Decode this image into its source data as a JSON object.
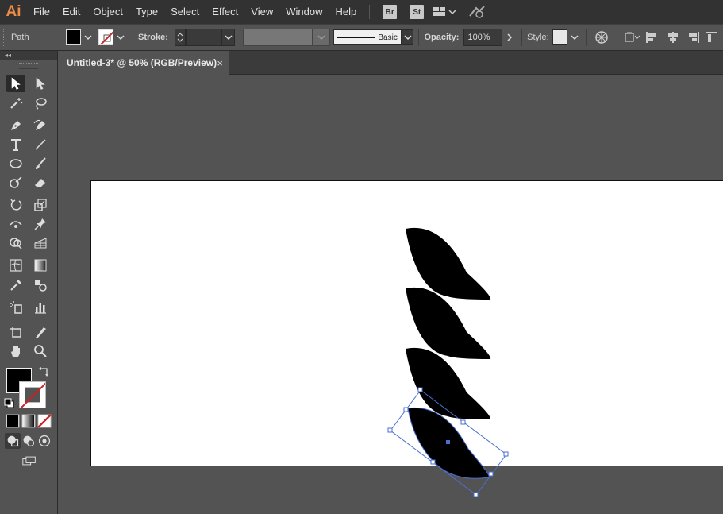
{
  "app": {
    "logo": "Ai",
    "brand_color": "#ee8c47"
  },
  "menu": {
    "items": [
      {
        "label": "File"
      },
      {
        "label": "Edit"
      },
      {
        "label": "Object"
      },
      {
        "label": "Type"
      },
      {
        "label": "Select"
      },
      {
        "label": "Effect"
      },
      {
        "label": "View"
      },
      {
        "label": "Window"
      },
      {
        "label": "Help"
      }
    ],
    "bridge_label": "Br",
    "stock_label": "St",
    "workspace_icon": "workspace-switcher-icon",
    "gpu_icon": "gpu-performance-icon"
  },
  "control": {
    "selection_type": "Path",
    "fill_color": "#000000",
    "stroke_color": "none",
    "stroke_label": "Stroke:",
    "stroke_value": "",
    "brush_label": "Basic",
    "opacity_label": "Opacity:",
    "opacity_value": "100%",
    "style_label": "Style:"
  },
  "tools": {
    "collapse_label": "◂◂",
    "items": [
      {
        "name": "selection-tool",
        "active": true
      },
      {
        "name": "direct-selection-tool",
        "active": false
      },
      {
        "name": "magic-wand-tool",
        "active": false
      },
      {
        "name": "lasso-tool",
        "active": false
      },
      {
        "name": "pen-tool",
        "active": false
      },
      {
        "name": "curvature-tool",
        "active": false
      },
      {
        "name": "type-tool",
        "active": false
      },
      {
        "name": "line-segment-tool",
        "active": false
      },
      {
        "name": "ellipse-tool",
        "active": false
      },
      {
        "name": "paintbrush-tool",
        "active": false
      },
      {
        "name": "shaper-tool",
        "active": false
      },
      {
        "name": "eraser-tool",
        "active": false
      },
      {
        "name": "rotate-tool",
        "active": false
      },
      {
        "name": "scale-tool",
        "active": false
      },
      {
        "name": "width-tool",
        "active": false
      },
      {
        "name": "puppet-warp-tool",
        "active": false
      },
      {
        "name": "shape-builder-tool",
        "active": false
      },
      {
        "name": "perspective-grid-tool",
        "active": false
      },
      {
        "name": "mesh-tool",
        "active": false
      },
      {
        "name": "gradient-tool",
        "active": false
      },
      {
        "name": "eyedropper-tool",
        "active": false
      },
      {
        "name": "blend-tool",
        "active": false
      },
      {
        "name": "symbol-sprayer-tool",
        "active": false
      },
      {
        "name": "column-graph-tool",
        "active": false
      },
      {
        "name": "artboard-tool",
        "active": false
      },
      {
        "name": "slice-tool",
        "active": false
      },
      {
        "name": "hand-tool",
        "active": false
      },
      {
        "name": "zoom-tool",
        "active": false
      }
    ],
    "fill_color": "#000000",
    "stroke_color": "none"
  },
  "document": {
    "tab_title": "Untitled-3* @ 50% (RGB/Preview)",
    "close_glyph": "×"
  },
  "artwork": {
    "leaf_color": "#000000",
    "selection_color": "#4a6fd1",
    "shapes": [
      "leaf",
      "leaf",
      "leaf",
      "leaf-selected"
    ]
  }
}
